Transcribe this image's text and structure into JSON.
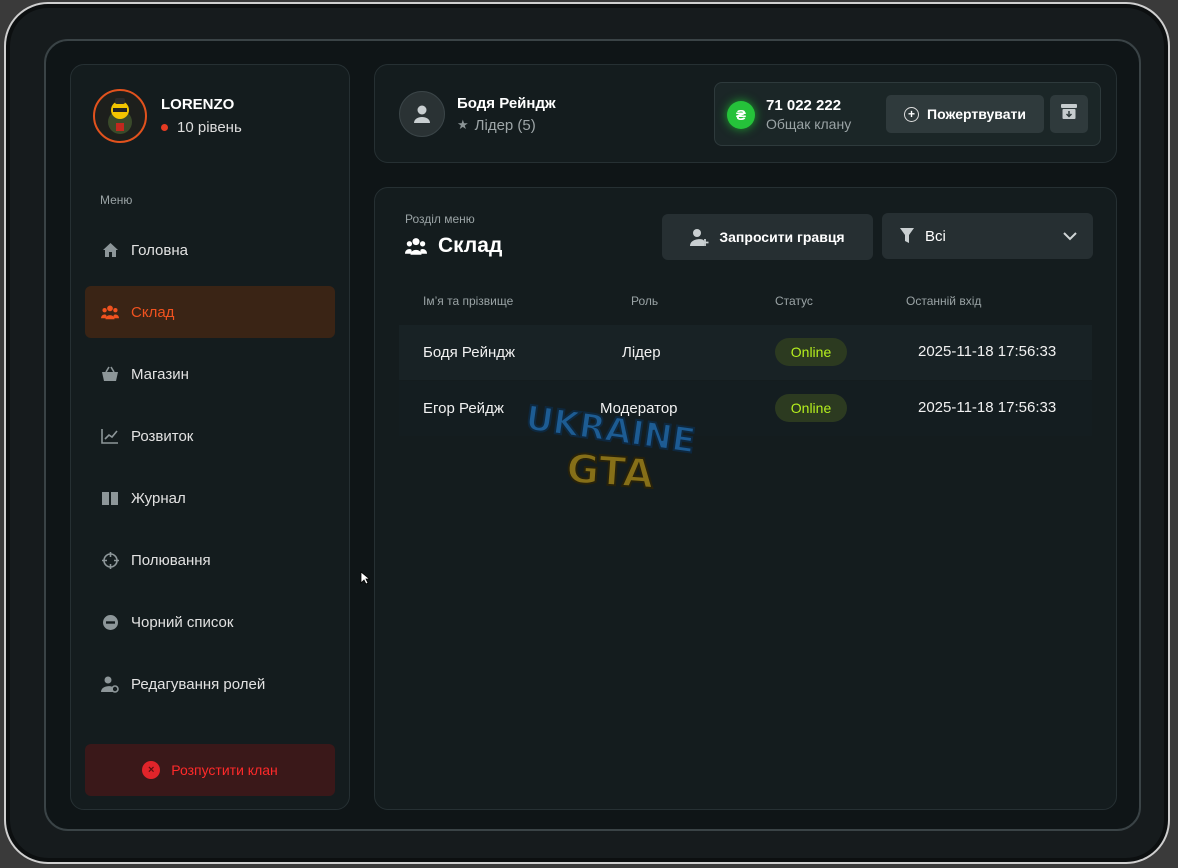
{
  "profile": {
    "name": "LORENZO",
    "level": "10 рівень"
  },
  "menu": {
    "label": "Меню",
    "items": [
      {
        "label": "Головна",
        "icon": "home-icon"
      },
      {
        "label": "Склад",
        "icon": "people-icon",
        "active": true
      },
      {
        "label": "Магазин",
        "icon": "basket-icon"
      },
      {
        "label": "Розвиток",
        "icon": "chart-icon"
      },
      {
        "label": "Журнал",
        "icon": "book-icon"
      },
      {
        "label": "Полювання",
        "icon": "crosshair-icon"
      },
      {
        "label": "Чорний список",
        "icon": "block-icon"
      },
      {
        "label": "Редагування ролей",
        "icon": "user-gear-icon"
      }
    ],
    "disband_label": "Розпустити клан"
  },
  "header": {
    "leader_name": "Бодя Рейндж",
    "leader_role": "Лідер (5)",
    "bank_amount": "71 022 222",
    "bank_label": "Общак клану",
    "currency_symbol": "₴",
    "donate_label": "Пожертвувати"
  },
  "section": {
    "label": "Розділ меню",
    "title": "Склад",
    "invite_label": "Запросити гравця",
    "filter_value": "Всі"
  },
  "table": {
    "headers": [
      "Ім’я та прізвище",
      "Роль",
      "Статус",
      "Останній вхід"
    ],
    "rows": [
      {
        "name": "Бодя Рейндж",
        "role": "Лідер",
        "status": "Online",
        "last": "2025-11-18 17:56:33"
      },
      {
        "name": "Егор Рейдж",
        "role": "Модератор",
        "status": "Online",
        "last": "2025-11-18 17:56:33"
      }
    ]
  },
  "watermark": {
    "line1": "UKRAINE",
    "line2": "GTA"
  },
  "colors": {
    "accent": "#f0521f",
    "online": "#b6f01e",
    "danger": "#ff2a2a",
    "money": "#25c23a"
  }
}
